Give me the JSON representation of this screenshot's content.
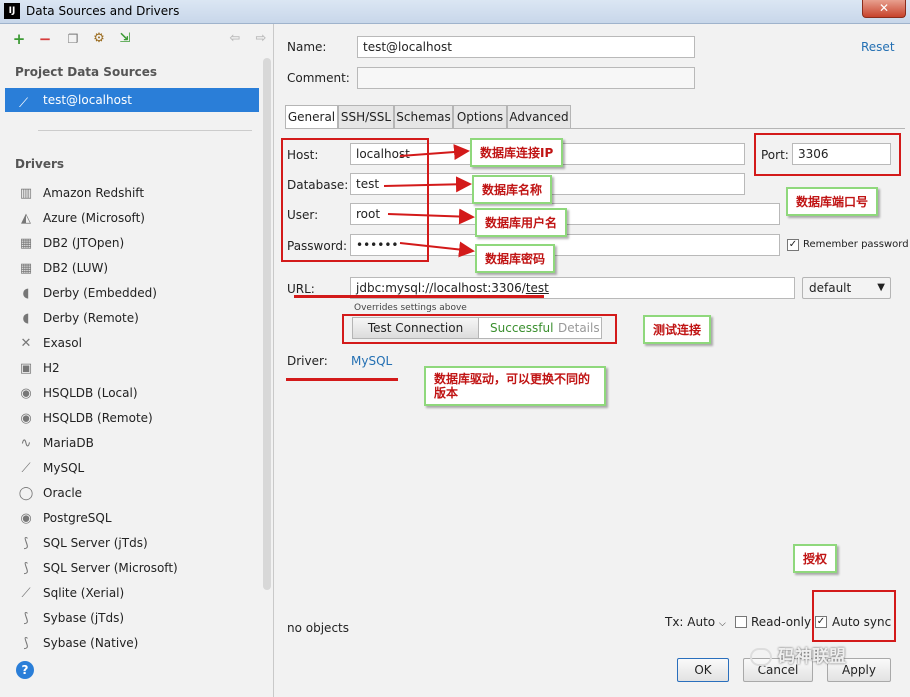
{
  "window": {
    "title": "Data Sources and Drivers",
    "app_icon": "IJ",
    "close_symbol": "✕"
  },
  "toolbar": {
    "add": "+",
    "remove": "−"
  },
  "sidebar": {
    "project_label": "Project Data Sources",
    "selected": "test@localhost",
    "drivers_label": "Drivers",
    "drivers": [
      "Amazon Redshift",
      "Azure (Microsoft)",
      "DB2 (JTOpen)",
      "DB2 (LUW)",
      "Derby (Embedded)",
      "Derby (Remote)",
      "Exasol",
      "H2",
      "HSQLDB (Local)",
      "HSQLDB (Remote)",
      "MariaDB",
      "MySQL",
      "Oracle",
      "PostgreSQL",
      "SQL Server (jTds)",
      "SQL Server (Microsoft)",
      "Sqlite (Xerial)",
      "Sybase (jTds)",
      "Sybase (Native)"
    ],
    "driver_icons": [
      "db-icon",
      "triangle-icon",
      "grid-icon",
      "grid-icon",
      "hat-icon",
      "hat-icon",
      "x-icon",
      "h2-icon",
      "elephant-icon",
      "elephant-icon",
      "seal-icon",
      "dolphin-icon",
      "ring-icon",
      "elephant-icon",
      "pipe-icon",
      "pipe-icon",
      "feather-icon",
      "pipe-icon",
      "pipe-icon"
    ],
    "help": "?"
  },
  "form": {
    "name_label": "Name:",
    "name_value": "test@localhost",
    "comment_label": "Comment:",
    "comment_value": "",
    "reset_label": "Reset",
    "tabs": [
      "General",
      "SSH/SSL",
      "Schemas",
      "Options",
      "Advanced"
    ],
    "host_label": "Host:",
    "host_value": "localhost",
    "port_label": "Port:",
    "port_value": "3306",
    "database_label": "Database:",
    "database_value": "test",
    "user_label": "User:",
    "user_value": "root",
    "password_label": "Password:",
    "password_value": "••••••",
    "remember_label": "Remember password",
    "remember_checked": true,
    "url_label": "URL:",
    "url_prefix": "jdbc:mysql://localhost:3306/",
    "url_db": "test",
    "url_mode": "default",
    "override_note": "Overrides settings above",
    "test_button": "Test Connection",
    "test_status": "Successful",
    "test_details": "Details",
    "driver_label": "Driver:",
    "driver_value": "MySQL"
  },
  "bottom": {
    "status": "no objects",
    "tx_label": "Tx: Auto",
    "readonly_label": "Read-only",
    "readonly_checked": false,
    "autosync_label": "Auto sync",
    "autosync_checked": true,
    "ok": "OK",
    "cancel": "Cancel",
    "apply": "Apply"
  },
  "annotations": {
    "host_note": "数据库连接IP",
    "db_note": "数据库名称",
    "user_note": "数据库用户名",
    "password_note": "数据库密码",
    "port_note": "数据库端口号",
    "test_note": "测试连接",
    "driver_note": "数据库驱动，可以更换不同的版本",
    "auth_note": "授权"
  },
  "watermark": "码神联盟",
  "colors": {
    "selection": "#2a7ed8",
    "annotation_red": "#d31a1a",
    "note_border": "#8fd87c",
    "success": "#3a8f2e",
    "link": "#2470b3"
  }
}
